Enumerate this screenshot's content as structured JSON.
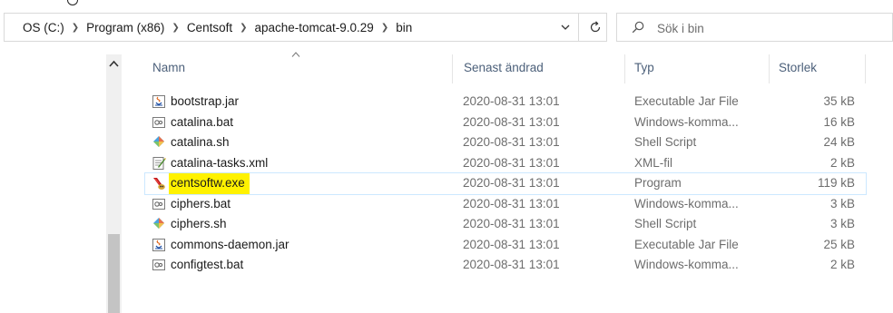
{
  "address_bar": {
    "crumbs": [
      "OS (C:)",
      "Program (x86)",
      "Centsoft",
      "apache-tomcat-9.0.29",
      "bin"
    ]
  },
  "search": {
    "placeholder": "Sök i bin"
  },
  "columns": {
    "name": "Namn",
    "modified": "Senast ändrad",
    "type": "Typ",
    "size": "Storlek"
  },
  "files": [
    {
      "name": "bootstrap.jar",
      "modified": "2020-08-31 13:01",
      "type": "Executable Jar File",
      "size": "35 kB",
      "icon": "jar-file-icon"
    },
    {
      "name": "catalina.bat",
      "modified": "2020-08-31 13:01",
      "type": "Windows-komma...",
      "size": "16 kB",
      "icon": "batch-file-icon"
    },
    {
      "name": "catalina.sh",
      "modified": "2020-08-31 13:01",
      "type": "Shell Script",
      "size": "24 kB",
      "icon": "shell-script-icon"
    },
    {
      "name": "catalina-tasks.xml",
      "modified": "2020-08-31 13:01",
      "type": "XML-fil",
      "size": "2 kB",
      "icon": "xml-file-icon"
    },
    {
      "name": "centsoftw.exe",
      "modified": "2020-08-31 13:01",
      "type": "Program",
      "size": "119 kB",
      "icon": "tomcat-exe-icon"
    },
    {
      "name": "ciphers.bat",
      "modified": "2020-08-31 13:01",
      "type": "Windows-komma...",
      "size": "3 kB",
      "icon": "batch-file-icon"
    },
    {
      "name": "ciphers.sh",
      "modified": "2020-08-31 13:01",
      "type": "Shell Script",
      "size": "3 kB",
      "icon": "shell-script-icon"
    },
    {
      "name": "commons-daemon.jar",
      "modified": "2020-08-31 13:01",
      "type": "Executable Jar File",
      "size": "25 kB",
      "icon": "jar-file-icon"
    },
    {
      "name": "configtest.bat",
      "modified": "2020-08-31 13:01",
      "type": "Windows-komma...",
      "size": "2 kB",
      "icon": "batch-file-icon"
    }
  ],
  "highlight_color": "#fff200",
  "selection_color": "#cce8ff"
}
